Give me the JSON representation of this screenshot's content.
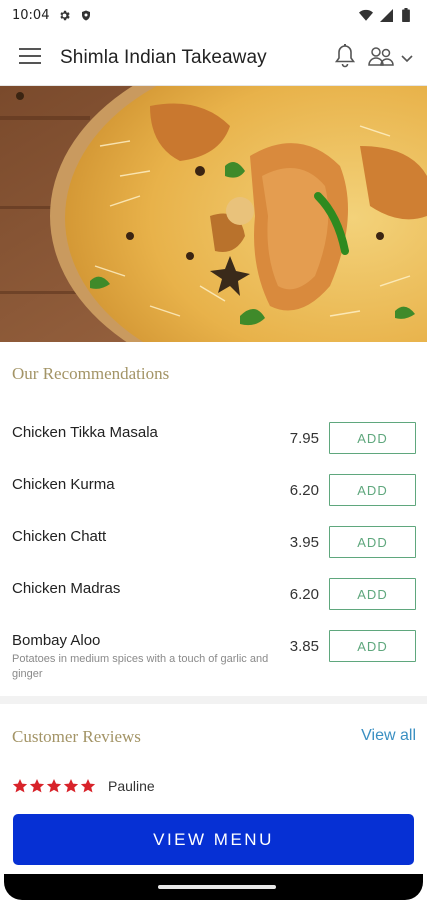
{
  "status_bar": {
    "time": "10:04",
    "icons": [
      "settings-icon",
      "shield-icon",
      "wifi-icon",
      "signal-icon",
      "battery-icon"
    ]
  },
  "app_bar": {
    "title": "Shimla Indian Takeaway",
    "icons": [
      "menu-icon",
      "bell-icon",
      "people-icon",
      "chevron-down-icon"
    ]
  },
  "hero": {
    "alt_subject": "biryani-image"
  },
  "recommendations": {
    "title": "Our Recommendations",
    "add_label": "ADD",
    "items": [
      {
        "name": "Chicken Tikka Masala",
        "price": "7.95",
        "description": ""
      },
      {
        "name": "Chicken Kurma",
        "price": "6.20",
        "description": ""
      },
      {
        "name": "Chicken Chatt",
        "price": "3.95",
        "description": ""
      },
      {
        "name": "Chicken Madras",
        "price": "6.20",
        "description": ""
      },
      {
        "name": "Bombay Aloo",
        "price": "3.85",
        "description": "Potatoes in medium spices with a touch of garlic and ginger"
      }
    ]
  },
  "reviews": {
    "title": "Customer Reviews",
    "view_all": "View all",
    "first_review": {
      "rating": 5,
      "reviewer": "Pauline"
    }
  },
  "cta": {
    "label": "VIEW MENU"
  },
  "colors": {
    "accent_gold": "#a39466",
    "add_green": "#5fa77d",
    "link_blue": "#3a8fc2",
    "cta_blue": "#0630d4",
    "star_red": "#d8232a"
  }
}
